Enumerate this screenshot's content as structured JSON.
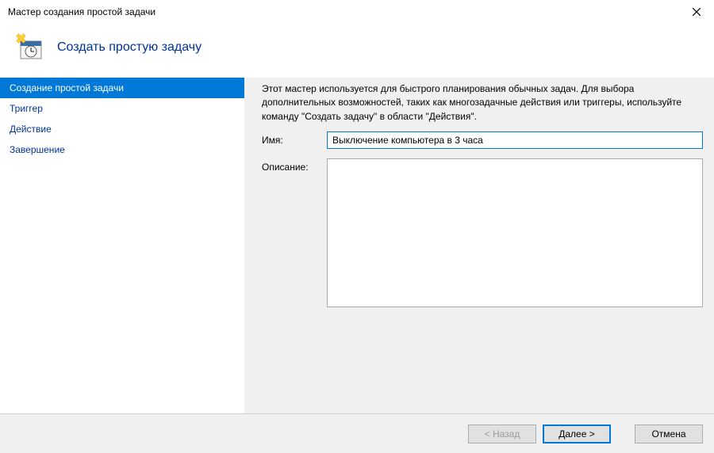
{
  "window": {
    "title": "Мастер создания простой задачи"
  },
  "header": {
    "title": "Создать простую задачу"
  },
  "sidebar": {
    "items": [
      {
        "label": "Создание простой задачи",
        "active": true
      },
      {
        "label": "Триггер",
        "active": false
      },
      {
        "label": "Действие",
        "active": false
      },
      {
        "label": "Завершение",
        "active": false
      }
    ]
  },
  "main": {
    "intro": "Этот мастер используется для быстрого планирования обычных задач.  Для выбора дополнительных возможностей, таких как многозадачные действия или триггеры, используйте команду \"Создать задачу\" в области \"Действия\".",
    "name_label": "Имя:",
    "name_value": "Выключение компьютера в 3 часа",
    "description_label": "Описание:",
    "description_value": ""
  },
  "footer": {
    "back": "< Назад",
    "next": "Далее >",
    "cancel": "Отмена"
  }
}
